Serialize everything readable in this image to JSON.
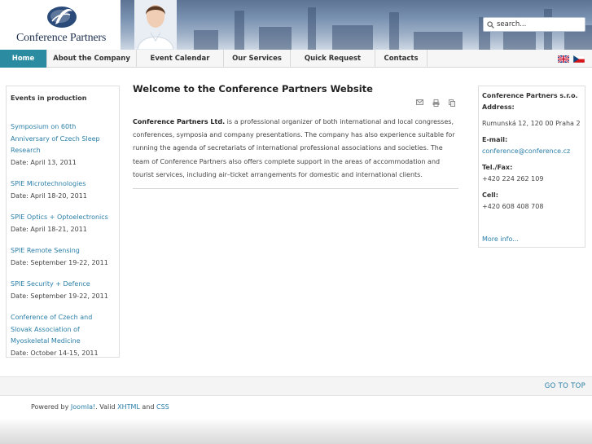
{
  "header": {
    "logo_text": "Conference Partners",
    "search_placeholder": "search..."
  },
  "nav": {
    "items": [
      {
        "label": "Home",
        "active": true
      },
      {
        "label": "About the Company",
        "active": false
      },
      {
        "label": "Event Calendar",
        "active": false
      },
      {
        "label": "Our Services",
        "active": false
      },
      {
        "label": "Quick Request",
        "active": false
      },
      {
        "label": "Contacts",
        "active": false
      }
    ]
  },
  "left": {
    "title": "Events in production",
    "events": [
      {
        "name": "Symposium on 60th Anniversary of Czech Sleep Research",
        "date": "Date: April 13, 2011"
      },
      {
        "name": "SPIE Microtechnologies",
        "date": "Date: April 18-20, 2011"
      },
      {
        "name": "SPIE Optics + Optoelectronics",
        "date": "Date: April 18-21, 2011"
      },
      {
        "name": "SPIE Remote Sensing",
        "date": "Date: September 19-22, 2011"
      },
      {
        "name": "SPIE Security + Defence",
        "date": "Date: September 19-22, 2011"
      },
      {
        "name": "Conference of Czech and Slovak Association of Myoskeletal Medicine",
        "date": "Date: October 14-15, 2011"
      }
    ]
  },
  "main": {
    "title": "Welcome to the Conference Partners Website",
    "company_bold": "Conference Partners Ltd.",
    "body": " is a professional organizer of both international and local congresses, conferences, symposia and company presentations. The company has also experience suitable for running the agenda of secretariats of international professional associations and societies. The team of Conference Partners also offers complete support in the areas of accommodation and tourist services, including air–ticket arrangements for domestic and international clients."
  },
  "right": {
    "company": "Conference Partners s.r.o.",
    "address_label": "Address:",
    "address": "Rumunská 12, 120 00 Praha 2",
    "email_label": "E-mail:",
    "email": "conference@conference.cz",
    "tel_label": "Tel./Fax:",
    "tel": "+420 224 262 109",
    "cell_label": "Cell:",
    "cell": "+420 608 408 708",
    "more": "More info..."
  },
  "footer": {
    "go_to_top": "GO TO TOP",
    "powered_prefix": "Powered by ",
    "joomla": "Joomla!",
    "valid": ". Valid ",
    "xhtml": "XHTML",
    "and": " and ",
    "css": "CSS"
  },
  "colors": {
    "accent": "#2b8ba0",
    "link": "#2b7fa8"
  }
}
